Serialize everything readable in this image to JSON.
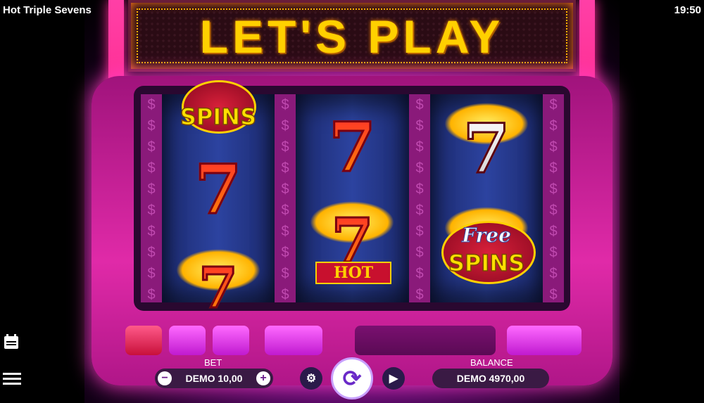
{
  "window": {
    "title": "Hot Triple Sevens",
    "clock": "19:50"
  },
  "sign": {
    "text": "LET'S PLAY"
  },
  "reels": [
    {
      "symbols": [
        "free-spins-partial",
        "red-seven",
        "hot-seven-partial"
      ]
    },
    {
      "symbols": [
        "red-seven",
        "hot-seven"
      ]
    },
    {
      "symbols": [
        "white-seven-flame",
        "free-spins"
      ]
    }
  ],
  "symbol_text": {
    "free": "Free",
    "spins": "SPINS",
    "spins_mixed": "SPINS",
    "hot": "HOT",
    "seven": "7"
  },
  "controls": {
    "bet_label": "BET",
    "bet_value": "DEMO 10,00",
    "balance_label": "BALANCE",
    "balance_value": "DEMO 4970,00",
    "minus": "−",
    "plus": "+",
    "icons": [
      "coins-settings-icon",
      "spin-icon",
      "autoplay-icon",
      "paytable-icon",
      "menu-icon"
    ]
  },
  "colors": {
    "accent": "#ff2aa6",
    "sign_text": "#ffd000",
    "pill": "#3a1a44"
  }
}
